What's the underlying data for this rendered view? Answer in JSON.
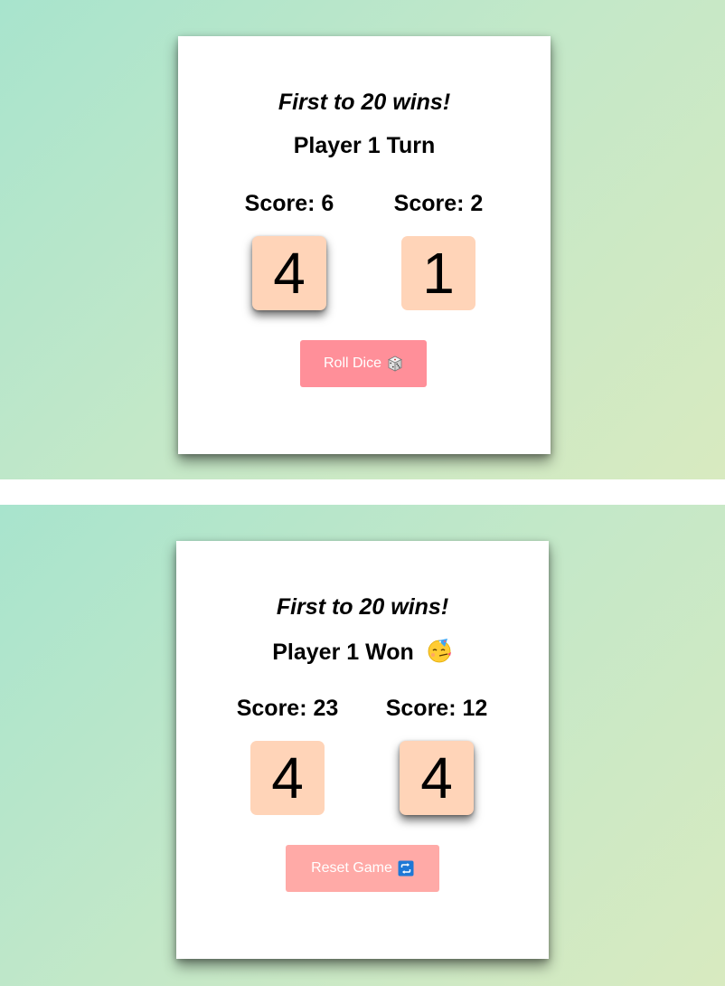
{
  "screens": [
    {
      "goal_text": "First to 20 wins!",
      "status_text": "Player 1 Turn",
      "players": [
        {
          "score_label": "Score: 6",
          "die_value": "4",
          "active": true
        },
        {
          "score_label": "Score: 2",
          "die_value": "1",
          "active": false
        }
      ],
      "button": {
        "label": "Roll Dice",
        "icon": "die-icon",
        "color": "#ff8f99"
      }
    },
    {
      "goal_text": "First to 20 wins!",
      "status_text": "Player 1 Won",
      "status_icon": "partying-face-icon",
      "players": [
        {
          "score_label": "Score: 23",
          "die_value": "4",
          "active": false
        },
        {
          "score_label": "Score: 12",
          "die_value": "4",
          "active": true
        }
      ],
      "button": {
        "label": "Reset Game",
        "icon": "repeat-icon",
        "color": "#ffaaa7"
      }
    }
  ],
  "colors": {
    "background_gradient": [
      "#a8e4cd",
      "#d8eac0"
    ],
    "die_face": "#ffd4b8"
  }
}
